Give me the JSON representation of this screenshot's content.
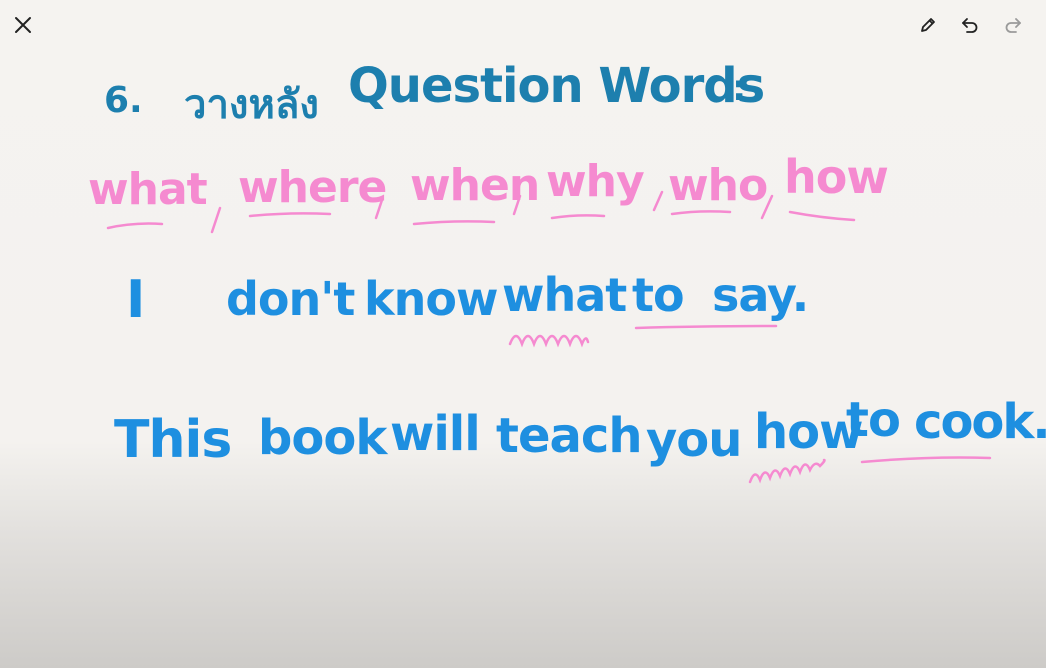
{
  "toolbar": {
    "close_icon": "close-icon",
    "pen_icon": "pencil-icon",
    "undo_icon": "undo-icon",
    "redo_icon": "redo-icon"
  },
  "colors": {
    "heading": "#1d7fae",
    "example_text": "#1e8fe0",
    "highlight": "#f58ad0"
  },
  "heading": {
    "number": "6.",
    "thai": "วางหลัง",
    "title": "Question Words",
    "colon": ":"
  },
  "question_words": [
    "what",
    "where",
    "when",
    "why",
    "who",
    "how"
  ],
  "sentences": [
    {
      "words": [
        "I",
        "don't",
        "know",
        "what",
        "to",
        "say."
      ]
    },
    {
      "words": [
        "This",
        "book",
        "will",
        "teach",
        "you",
        "how",
        "to",
        "cook."
      ]
    }
  ]
}
